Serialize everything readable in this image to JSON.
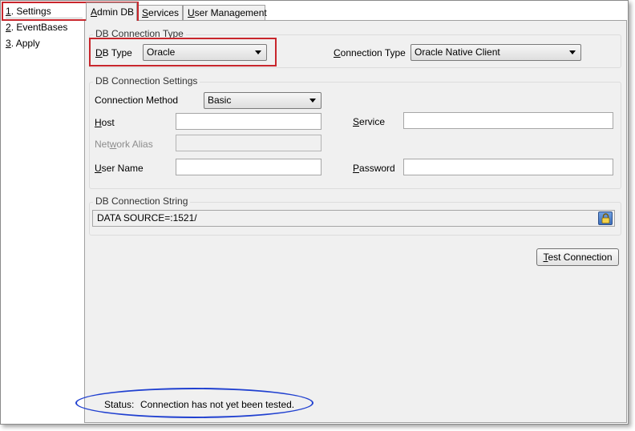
{
  "nav": {
    "items": [
      {
        "num": "1",
        "label": ". Settings"
      },
      {
        "num": "2",
        "label": ". EventBases"
      },
      {
        "num": "3",
        "label": ". Apply"
      }
    ]
  },
  "tabs": [
    {
      "accel": "A",
      "rest": "dmin DB"
    },
    {
      "accel": "S",
      "rest": "ervices"
    },
    {
      "accel": "U",
      "rest": "ser Management"
    }
  ],
  "connection_type_group": {
    "title": "DB Connection Type",
    "db_type_accel": "D",
    "db_type_rest": "B Type",
    "db_type_value": "Oracle",
    "conn_type_accel": "C",
    "conn_type_rest": "onnection Type",
    "conn_type_value": "Oracle Native Client"
  },
  "connection_settings_group": {
    "title": "DB Connection Settings",
    "method_label": "Connection Method",
    "method_value": "Basic",
    "host_accel": "H",
    "host_rest": "ost",
    "host_value": "",
    "service_accel": "S",
    "service_rest": "ervice",
    "service_value": "",
    "alias_pre": "Net",
    "alias_accel": "w",
    "alias_post": "ork Alias",
    "alias_value": "",
    "username_accel": "U",
    "username_rest": "ser Name",
    "username_value": "",
    "password_accel": "P",
    "password_rest": "assword",
    "password_value": ""
  },
  "connection_string_group": {
    "title_pre": "DB Connection Strin",
    "title_accel": "g",
    "value": "DATA SOURCE=:1521/"
  },
  "test_button": {
    "accel": "T",
    "rest": "est Connection"
  },
  "status": {
    "label": "Status:",
    "text": "Connection has not yet been tested."
  },
  "icons": {
    "lock": "lock-icon",
    "dropdown": "chevron-down-icon"
  },
  "colors": {
    "highlight_box": "#c8262c",
    "highlight_ellipse": "#2040d0",
    "panel_bg": "#f0f0f0"
  }
}
